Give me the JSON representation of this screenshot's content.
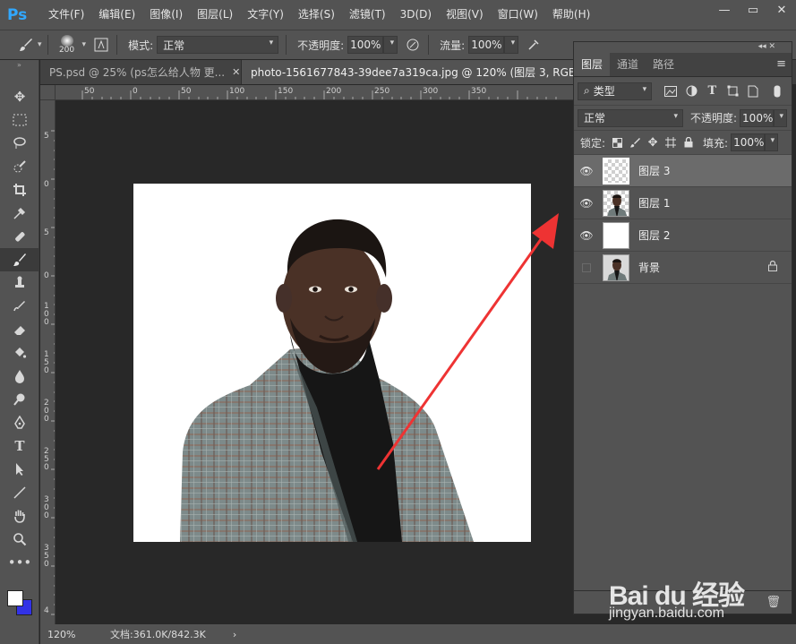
{
  "app": {
    "logo": "Ps"
  },
  "menu": [
    "文件(F)",
    "编辑(E)",
    "图像(I)",
    "图层(L)",
    "文字(Y)",
    "选择(S)",
    "滤镜(T)",
    "3D(D)",
    "视图(V)",
    "窗口(W)",
    "帮助(H)"
  ],
  "window_controls": {
    "minimize": "—",
    "restore": "▭",
    "close": "✕"
  },
  "options": {
    "brush_size": "200",
    "mode_label": "模式:",
    "mode_value": "正常",
    "opacity_label": "不透明度:",
    "opacity_value": "100%",
    "flow_label": "流量:",
    "flow_value": "100%"
  },
  "tabs": [
    {
      "label": "PS.psd @ 25% (ps怎么给人物 更...",
      "close": "✕"
    },
    {
      "label": "photo-1561677843-39dee7a319ca.jpg @ 120% (图层 3, RGB/8) *",
      "close": "✕"
    }
  ],
  "ruler_top": [
    "50",
    "0",
    "50",
    "100",
    "150",
    "200",
    "250",
    "300",
    "350"
  ],
  "ruler_left": [
    "5",
    "0",
    "5",
    "0",
    "1\n0\n0",
    "1\n5\n0",
    "2\n0\n0",
    "2\n5\n0",
    "3\n0\n0",
    "3\n5\n0",
    "4"
  ],
  "status": {
    "zoom": "120%",
    "doc": "文档:361.0K/842.3K",
    "arrow": "›"
  },
  "layers_panel": {
    "tabs": [
      "图层",
      "通道",
      "路径"
    ],
    "filter_kind": "类型",
    "blend_mode": "正常",
    "opacity_label": "不透明度:",
    "opacity_value": "100%",
    "lock_label": "锁定:",
    "fill_label": "填充:",
    "fill_value": "100%",
    "layers": [
      {
        "name": "图层 3",
        "visible": true,
        "selected": true
      },
      {
        "name": "图层 1",
        "visible": true,
        "selected": false
      },
      {
        "name": "图层 2",
        "visible": true,
        "selected": false
      },
      {
        "name": "背景",
        "visible": false,
        "selected": false,
        "locked": true
      }
    ]
  },
  "watermark": {
    "main": "Bai du 经验",
    "sub": "jingyan.baidu.com"
  },
  "colors": {
    "foreground": "#ffffff",
    "background": "#3232e6",
    "annotation_arrow": "#ee3333"
  }
}
